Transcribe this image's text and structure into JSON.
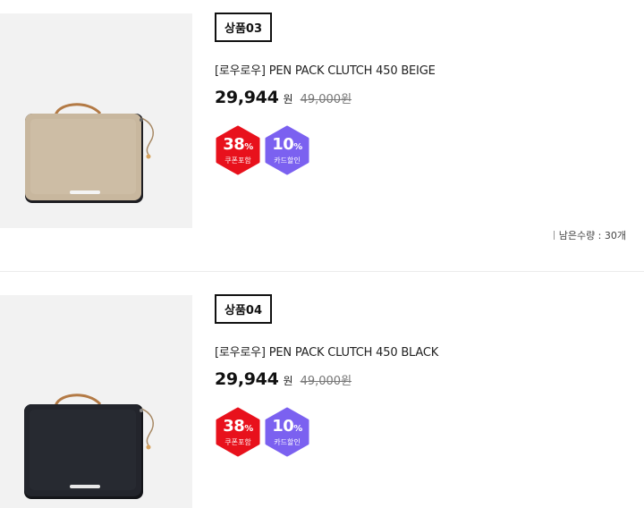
{
  "products": [
    {
      "badge": "상품03",
      "name": "[로우로우] PEN PACK CLUTCH 450 BEIGE",
      "price": "29,944",
      "currency": "원",
      "original_price": "49,000원",
      "coupon": {
        "value": "38",
        "unit": "%",
        "label": "쿠폰포함",
        "color": "#e8111c"
      },
      "card": {
        "value": "10",
        "unit": "%",
        "label": "카드할인",
        "color": "#7b61f0"
      },
      "stock": "남은수량 : 30개",
      "image_color": "#c9b8a0"
    },
    {
      "badge": "상품04",
      "name": "[로우로우] PEN PACK CLUTCH 450 BLACK",
      "price": "29,944",
      "currency": "원",
      "original_price": "49,000원",
      "coupon": {
        "value": "38",
        "unit": "%",
        "label": "쿠폰포함",
        "color": "#e8111c"
      },
      "card": {
        "value": "10",
        "unit": "%",
        "label": "카드할인",
        "color": "#7b61f0"
      },
      "image_color": "#23252c"
    }
  ]
}
